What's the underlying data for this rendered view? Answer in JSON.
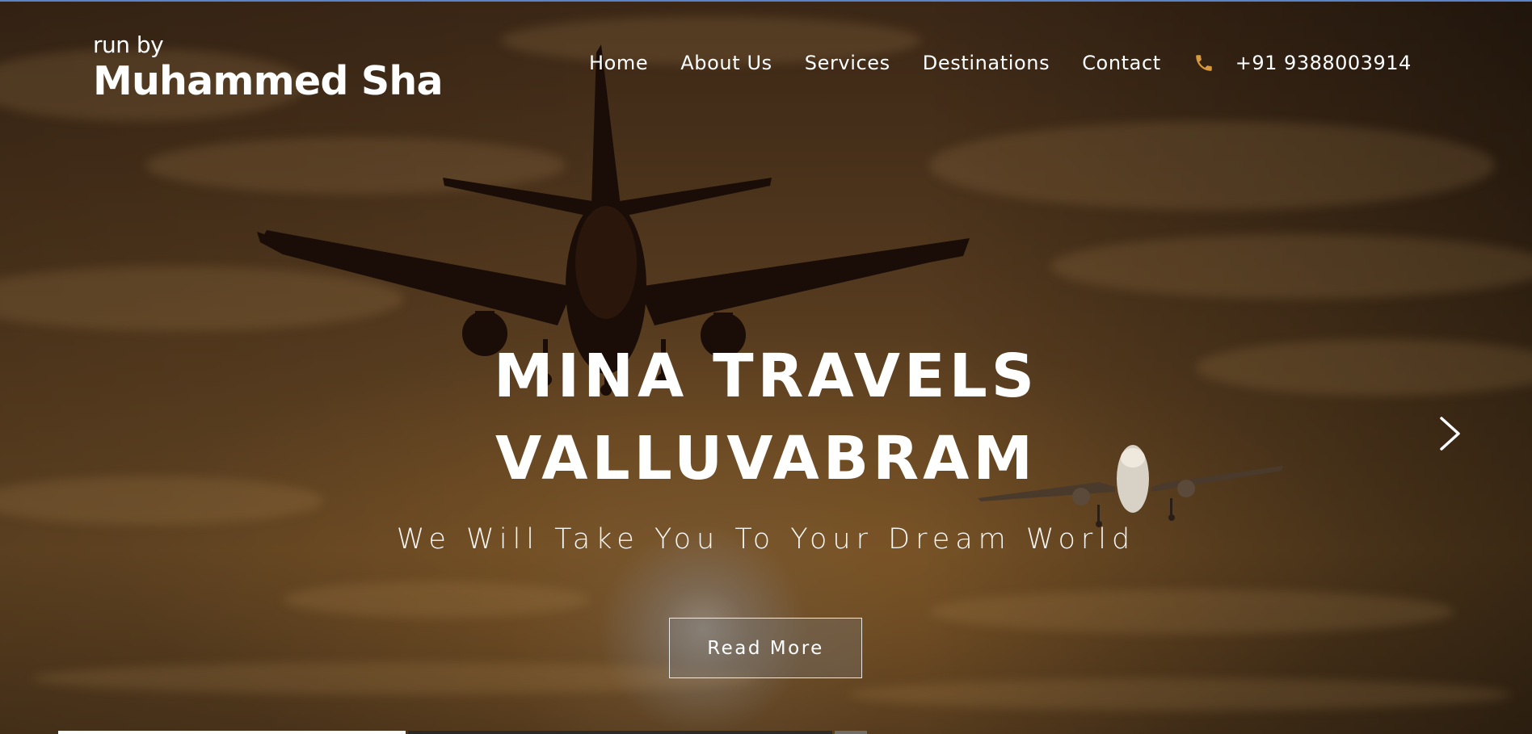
{
  "brand": {
    "sub": "run by",
    "name": "Muhammed Sha"
  },
  "nav": {
    "items": [
      {
        "label": "Home",
        "active": true
      },
      {
        "label": "About Us"
      },
      {
        "label": "Services"
      },
      {
        "label": "Destinations"
      },
      {
        "label": "Contact"
      }
    ],
    "phone_icon": "phone-icon",
    "phone": "+91 9388003914"
  },
  "hero": {
    "title_line1": "MINA TRAVELS",
    "title_line2": "VALLUVABRAM",
    "tagline": "We Will Take You To Your Dream World",
    "button_label": "Read More",
    "next_icon": "chevron-right-icon"
  },
  "colors": {
    "accent": "#d89a3c",
    "topline": "#5b84c8"
  },
  "carousel": {
    "slide_count": 3,
    "active_slide": 1
  }
}
